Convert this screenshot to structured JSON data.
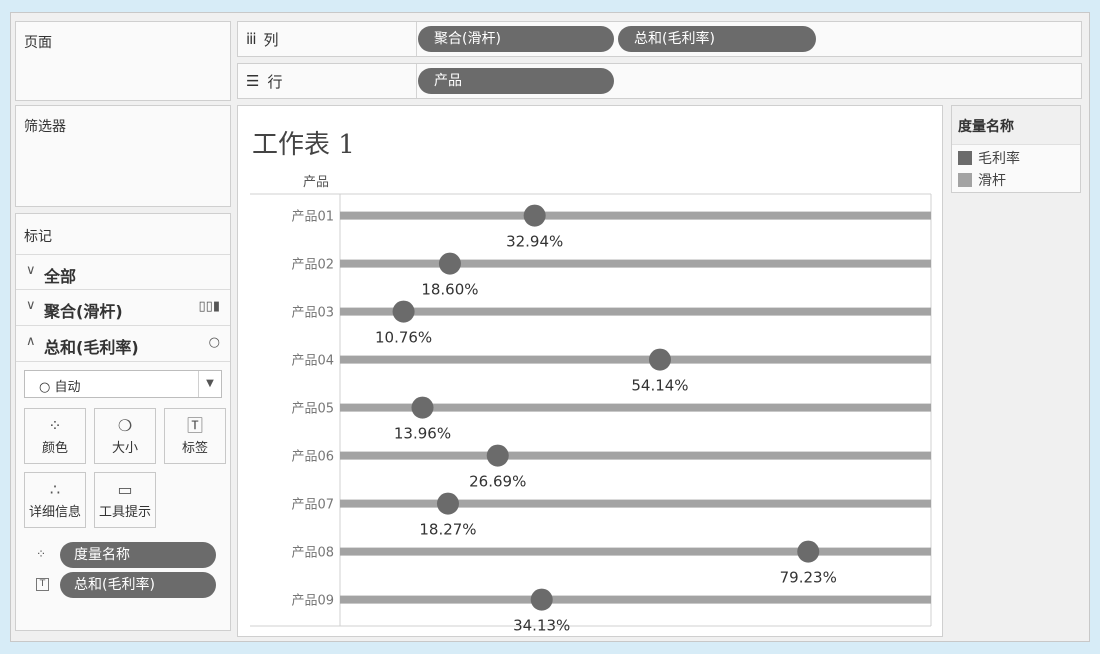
{
  "pages_panel": {
    "title": "页面"
  },
  "filters_panel": {
    "title": "筛选器"
  },
  "shelves": {
    "columns": {
      "icon": "columns-icon",
      "label": "列",
      "pills": [
        "聚合(滑杆)",
        "总和(毛利率)"
      ]
    },
    "rows": {
      "icon": "rows-icon",
      "label": "行",
      "pills": [
        "产品"
      ]
    }
  },
  "marks_card": {
    "title": "标记",
    "items": [
      {
        "label": "全部",
        "state": "collapsed",
        "icon": ""
      },
      {
        "label": "聚合(滑杆)",
        "state": "collapsed",
        "icon": "bar-chart-icon"
      },
      {
        "label": "总和(毛利率)",
        "state": "expanded",
        "icon": "circle-icon"
      }
    ],
    "mark_type": "自动",
    "buttons": [
      "颜色",
      "大小",
      "标签",
      "详细信息",
      "工具提示"
    ],
    "fields": [
      {
        "icon": "color-dots-icon",
        "label": "度量名称"
      },
      {
        "icon": "label-t-icon",
        "label": "总和(毛利率)"
      }
    ]
  },
  "sheet": {
    "title": "工作表 1"
  },
  "legend": {
    "title": "度量名称",
    "items": [
      {
        "label": "毛利率",
        "color": "#6b6b6b"
      },
      {
        "label": "滑杆",
        "color": "#a3a3a3"
      }
    ]
  },
  "chart_data": {
    "type": "dot-on-bar",
    "row_header": "产品",
    "categories": [
      "产品01",
      "产品02",
      "产品03",
      "产品04",
      "产品05",
      "产品06",
      "产品07",
      "产品08",
      "产品09"
    ],
    "series": [
      {
        "name": "毛利率",
        "values": [
          32.94,
          18.6,
          10.76,
          54.14,
          13.96,
          26.69,
          18.27,
          79.23,
          34.13
        ],
        "color": "#6b6b6b"
      },
      {
        "name": "滑杆",
        "values": [
          100,
          100,
          100,
          100,
          100,
          100,
          100,
          100,
          100
        ],
        "color": "#a3a3a3"
      }
    ],
    "data_labels": [
      "32.94%",
      "18.60%",
      "10.76%",
      "54.14%",
      "13.96%",
      "26.69%",
      "18.27%",
      "79.23%",
      "34.13%"
    ],
    "xlim": [
      0,
      100
    ],
    "grid": false
  }
}
